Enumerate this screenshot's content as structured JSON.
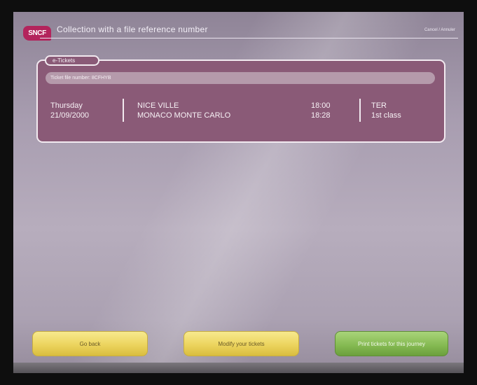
{
  "header": {
    "logo_text": "SNCF",
    "title": "Collection with a file reference number",
    "right_link": "Cancel / Annuler"
  },
  "ticket_panel": {
    "tab_label": "e-Tickets",
    "reference_label": "Ticket file number: 8CFHYB",
    "journey": {
      "day": "Thursday",
      "date": "21/09/2000",
      "origin": "NICE VILLE",
      "destination": "MONACO MONTE CARLO",
      "departure_time": "18:00",
      "arrival_time": "18:28",
      "train_type": "TER",
      "class": "1st class"
    }
  },
  "buttons": {
    "back": "Go back",
    "modify": "Modify your tickets",
    "print": "Print tickets for this journey"
  }
}
